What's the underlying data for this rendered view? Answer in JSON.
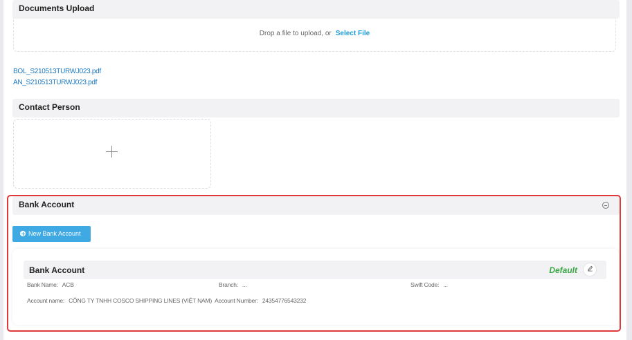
{
  "documents": {
    "header": "Documents Upload",
    "drop_text": "Drop a file to upload, or",
    "select_file": "Select File",
    "files": [
      "BOL_S210513TURWJ023.pdf",
      "AN_S210513TURWJ023.pdf"
    ]
  },
  "contact": {
    "header": "Contact Person"
  },
  "bank": {
    "header": "Bank Account",
    "new_button": "New Bank Account",
    "card": {
      "title": "Bank Account",
      "default_label": "Default",
      "bank_name_label": "Bank Name:",
      "bank_name_value": "ACB",
      "branch_label": "Branch:",
      "branch_value": "...",
      "swift_label": "Swift Code:",
      "swift_value": "...",
      "account_name_label": "Account name:",
      "account_name_value": "CÔNG TY TNHH COSCO SHIPPING LINES (VIỆT NAM)",
      "account_number_label": "Account Number:",
      "account_number_value": "24354776543232"
    }
  },
  "colors": {
    "accent": "#1c9bd7",
    "button": "#3ea9e2",
    "highlight_frame": "#e0393c",
    "default_tag": "#3aa845"
  }
}
